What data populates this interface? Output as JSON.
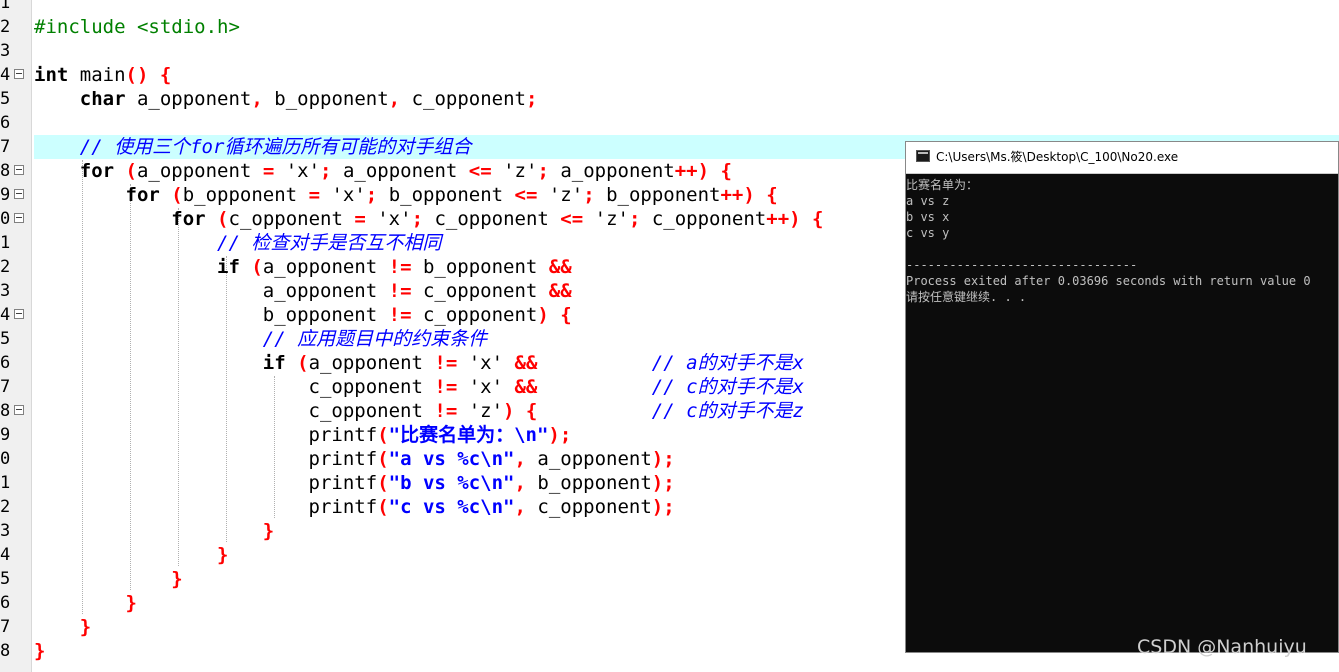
{
  "gutter": {
    "line_numbers": [
      "1",
      "2",
      "3",
      "4",
      "5",
      "6",
      "7",
      "8",
      "9",
      "0",
      "1",
      "2",
      "3",
      "4",
      "5",
      "6",
      "7",
      "8",
      "9",
      "0",
      "1",
      "2",
      "3",
      "4",
      "5",
      "6",
      "7",
      "8"
    ]
  },
  "code": {
    "l2": "#include <stdio.h>",
    "l4_kw": "int",
    "l4_name": " main",
    "l4_paren": "() {",
    "l5_kw": "char",
    "l5_var1": " a_opponent",
    "l5_comma1": ",",
    "l5_var2": " b_opponent",
    "l5_comma2": ",",
    "l5_var3": " c_opponent",
    "l5_semi": ";",
    "l7_comment": "// 使用三个for循环遍历所有可能的对手组合",
    "l8_kw": "for",
    "l8_open": " (",
    "l8_a": "a_opponent ",
    "l8_eq": "=",
    "l8_lit1": " 'x'",
    "l8_semi1": ";",
    "l8_b": " a_opponent ",
    "l8_le": "<=",
    "l8_lit2": " 'z'",
    "l8_semi2": ";",
    "l8_c": " a_opponent",
    "l8_inc": "++",
    "l8_close": ") {",
    "l9_kw": "for",
    "l9_open": " (",
    "l9_a": "b_opponent ",
    "l9_eq": "=",
    "l9_lit1": " 'x'",
    "l9_semi1": ";",
    "l9_b": " b_opponent ",
    "l9_le": "<=",
    "l9_lit2": " 'z'",
    "l9_semi2": ";",
    "l9_c": " b_opponent",
    "l9_inc": "++",
    "l9_close": ") {",
    "l10_kw": "for",
    "l10_open": " (",
    "l10_a": "c_opponent ",
    "l10_eq": "=",
    "l10_lit1": " 'x'",
    "l10_semi1": ";",
    "l10_b": " c_opponent ",
    "l10_le": "<=",
    "l10_lit2": " 'z'",
    "l10_semi2": ";",
    "l10_c": " c_opponent",
    "l10_inc": "++",
    "l10_close": ") {",
    "l11_comment": "// 检查对手是否互不相同",
    "l12_kw": "if",
    "l12_open": " (",
    "l12_a": "a_opponent ",
    "l12_ne": "!=",
    "l12_b": " b_opponent ",
    "l12_and": "&&",
    "l13_a": "a_opponent ",
    "l13_ne": "!=",
    "l13_b": " c_opponent ",
    "l13_and": "&&",
    "l14_a": "b_opponent ",
    "l14_ne": "!=",
    "l14_b": " c_opponent",
    "l14_close": ") {",
    "l15_comment": "// 应用题目中的约束条件",
    "l16_kw": "if",
    "l16_open": " (",
    "l16_a": "a_opponent ",
    "l16_ne": "!=",
    "l16_lit": " 'x' ",
    "l16_and": "&&",
    "l16_pad": "          ",
    "l16_comment": "// a的对手不是x",
    "l17_a": "c_opponent ",
    "l17_ne": "!=",
    "l17_lit": " 'x' ",
    "l17_and": "&&",
    "l17_pad": "          ",
    "l17_comment": "// c的对手不是x",
    "l18_a": "c_opponent ",
    "l18_ne": "!=",
    "l18_lit": " 'z'",
    "l18_close": ") {",
    "l18_pad": "          ",
    "l18_comment": "// c的对手不是z",
    "l19_fn": "printf",
    "l19_open": "(",
    "l19_str": "\"比赛名单为：\\n\"",
    "l19_close": ");",
    "l20_fn": "printf",
    "l20_open": "(",
    "l20_str": "\"a vs %c\\n\"",
    "l20_comma": ",",
    "l20_arg": " a_opponent",
    "l20_close": ");",
    "l21_fn": "printf",
    "l21_open": "(",
    "l21_str": "\"b vs %c\\n\"",
    "l21_comma": ",",
    "l21_arg": " b_opponent",
    "l21_close": ");",
    "l22_fn": "printf",
    "l22_open": "(",
    "l22_str": "\"c vs %c\\n\"",
    "l22_comma": ",",
    "l22_arg": " c_opponent",
    "l22_close": ");",
    "brace": "}"
  },
  "console": {
    "title": "C:\\Users\\Ms.筱\\Desktop\\C_100\\No20.exe",
    "output": [
      "比赛名单为：",
      "a vs z",
      "b vs x",
      "c vs y",
      "",
      "--------------------------------",
      "Process exited after 0.03696 seconds with return value 0",
      "请按任意键继续. . ."
    ]
  },
  "watermark": "CSDN @Nanhuiyu",
  "colors": {
    "keyword": "#000000",
    "preprocessor": "#008000",
    "operator": "#ff0000",
    "comment": "#0000ff",
    "string": "#0000ff",
    "highlight_line": "#ccffff",
    "console_bg": "#0c0c0c",
    "console_text": "#c0c0c0"
  },
  "icons": {
    "fold": "fold-minus-icon",
    "console": "console-app-icon"
  }
}
